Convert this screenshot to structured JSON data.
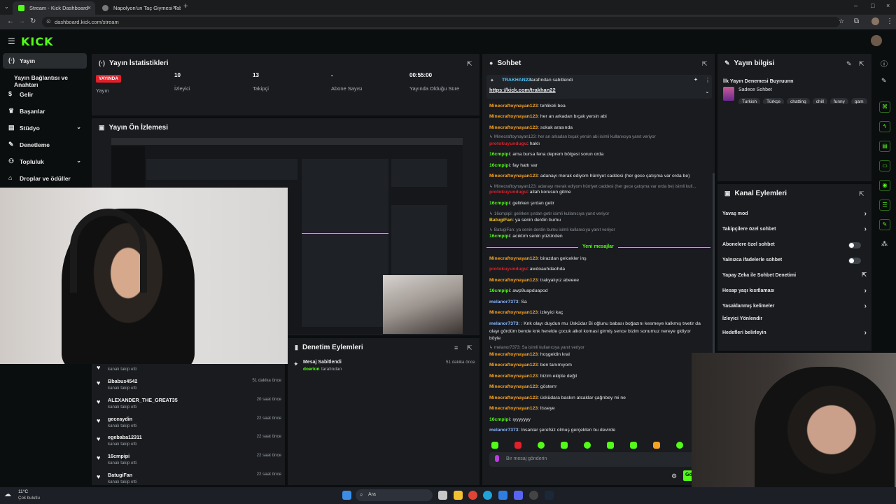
{
  "browser": {
    "tabs": [
      {
        "title": "Stream - Kick Dashboard",
        "active": true
      },
      {
        "title": "Napolyon'un Taç Giymesi Tablo",
        "active": false
      }
    ],
    "url": "dashboard.kick.com/stream"
  },
  "brand": {
    "logo": "KICK",
    "accent": "#53fc18"
  },
  "sidebar": {
    "items": [
      {
        "label": "Yayın",
        "icon": "broadcast-icon",
        "active": true
      },
      {
        "label": "Yayın Bağlantısı ve Anahtarı",
        "icon": "",
        "active": false
      },
      {
        "label": "Gelir",
        "icon": "dollar-icon",
        "active": false
      },
      {
        "label": "Başarılar",
        "icon": "trophy-icon",
        "active": false
      },
      {
        "label": "Stüdyo",
        "icon": "studio-icon",
        "active": false
      },
      {
        "label": "Denetleme",
        "icon": "wrench-icon",
        "active": false
      },
      {
        "label": "Topluluk",
        "icon": "community-icon",
        "active": false
      },
      {
        "label": "Droplar ve ödüller",
        "icon": "gift-icon",
        "active": false
      }
    ]
  },
  "stats": {
    "title": "Yayın İstatistikleri",
    "live_badge": "YAYINDA",
    "items": [
      {
        "value": "",
        "label": "Yayın"
      },
      {
        "value": "10",
        "label": "İzleyici"
      },
      {
        "value": "13",
        "label": "Takipçi"
      },
      {
        "value": "-",
        "label": "Abone Sayısı"
      },
      {
        "value": "00:55:00",
        "label": "Yayında Olduğu Süre"
      }
    ]
  },
  "preview": {
    "title": "Yayın Ön İzlemesi"
  },
  "feed": {
    "items": [
      {
        "name": "",
        "sub": "kanalı takip etti",
        "time": ""
      },
      {
        "name": "Bbabus4542",
        "sub": "kanalı takip etti",
        "time": "51 dakika önce"
      },
      {
        "name": "ALEXANDER_THE_GREAT35",
        "sub": "kanalı takip etti",
        "time": "20 saat önce"
      },
      {
        "name": "geceaydin",
        "sub": "kanalı takip etti",
        "time": "22 saat önce"
      },
      {
        "name": "egebaba12311",
        "sub": "kanalı takip etti",
        "time": "22 saat önce"
      },
      {
        "name": "16cmpipi",
        "sub": "kanalı takip etti",
        "time": "22 saat önce"
      },
      {
        "name": "BatugiFan",
        "sub": "kanalı takip etti",
        "time": "22 saat önce"
      }
    ]
  },
  "mod_actions": {
    "title": "Denetim Eylemleri",
    "item_title": "Mesaj Sabitlendi",
    "item_user": "doerkın",
    "item_suffix": "tarafından",
    "item_time": "51 dakika önce"
  },
  "chat": {
    "title": "Sohbet",
    "pinned_by_user": "TRAKHAN22",
    "pinned_by_suffix": "tarafından sabitlendi",
    "pinned_link": "https://kick.com/trakhan22",
    "new_messages_label": "Yeni mesajlar",
    "input_placeholder": "Bir mesaj gönderin",
    "send_label": "Gö",
    "lines": [
      {
        "type": "msg",
        "user": "Minecraftoynayan123",
        "color": "#f7a123",
        "text": ": tehlikeli bea"
      },
      {
        "type": "msg",
        "user": "Minecraftoynayan123",
        "color": "#f7a123",
        "text": ": her an arkadan bıçak yersin abi"
      },
      {
        "type": "msg",
        "user": "Minecraftoynayan123",
        "color": "#f7a123",
        "text": ": sokak arasında"
      },
      {
        "type": "reply",
        "text": "↳ Minecraftoynayan123: her an arkadan bıçak yersin abi isimli kullanıcıya yanıt veriyor"
      },
      {
        "type": "msg",
        "user": "protokuyundugu",
        "color": "#e0202a",
        "text": ": haklı"
      },
      {
        "type": "msg",
        "user": "16cmpipi",
        "color": "#53fc18",
        "text": ": ama bursa fena deprem bölgesi sorun orda"
      },
      {
        "type": "msg",
        "user": "16cmpipi",
        "color": "#53fc18",
        "text": ": fay hattı var"
      },
      {
        "type": "msg",
        "user": "Minecraftoynayan123",
        "color": "#f7a123",
        "text": ": adanayı merak ediyom hürriyet caddesi (her gece çatışma var orda be)"
      },
      {
        "type": "reply",
        "text": "↳ Minecraftoynayan123: adanayı merak ediyom hürriyet caddesi (her gece çatışma var orda be) isimli kull..."
      },
      {
        "type": "msg",
        "user": "protokuyundugu",
        "color": "#e0202a",
        "text": ": allah korusun gitme"
      },
      {
        "type": "msg",
        "user": "16cmpipi",
        "color": "#53fc18",
        "text": ": gelirken şırdan getir"
      },
      {
        "type": "reply",
        "text": "↳ 16cmpipi: gelirken şırdan getir isimli kullanıcıya yanıt veriyor"
      },
      {
        "type": "msg",
        "user": "BatugiFan",
        "color": "#f7c623",
        "text": ": ya senin derdin bumu"
      },
      {
        "type": "reply",
        "text": "↳ BatugiFan: ya senin derdin bumu isimli kullanıcıya yanıt veriyor"
      },
      {
        "type": "msg",
        "user": "16cmpipi",
        "color": "#53fc18",
        "text": ": acıktım senin yüzünden"
      },
      {
        "type": "msg",
        "user": "Minecraftoynayan123",
        "color": "#f7a123",
        "text": ": birazdan gelcekler inş"
      },
      {
        "type": "msg",
        "user": "protokuyundugu",
        "color": "#e0202a",
        "text": ": awdoauhdaohda"
      },
      {
        "type": "msg",
        "user": "Minecraftoynayan123",
        "color": "#f7a123",
        "text": ": trakyalıyız abeeee"
      },
      {
        "type": "msg",
        "user": "16cmpipi",
        "color": "#53fc18",
        "text": ": awp9uapduapod"
      },
      {
        "type": "msg",
        "user": "melanor7373",
        "color": "#8ab4f8",
        "text": ": Sa"
      },
      {
        "type": "msg",
        "user": "Minecraftoynayan123",
        "color": "#f7a123",
        "text": ": izleyici kaç"
      },
      {
        "type": "msg",
        "user": "melanor7373",
        "color": "#8ab4f8",
        "text": ": : Knk olayı duydun mu Üsküdar Bi oğlunu babası boğazını kesmeye kalkmış twetir da"
      },
      {
        "type": "cont",
        "text": "olayı gördüm bende knk herelde çocuk alkol komasi girmiş sence bizim sonumuz nereye gidiyor"
      },
      {
        "type": "cont",
        "text": "böyle"
      },
      {
        "type": "reply",
        "text": "↳ melanor7373: Sa isimli kullanıcıya yanıt veriyor"
      },
      {
        "type": "msg",
        "user": "Minecraftoynayan123",
        "color": "#f7a123",
        "text": ": hoşgeldin kral"
      },
      {
        "type": "msg",
        "user": "Minecraftoynayan123",
        "color": "#f7a123",
        "text": ": ben tanımıyom"
      },
      {
        "type": "msg",
        "user": "Minecraftoynayan123",
        "color": "#f7a123",
        "text": ": bizim ekipte değil"
      },
      {
        "type": "msg",
        "user": "Minecraftoynayan123",
        "color": "#f7a123",
        "text": ": gösterrr"
      },
      {
        "type": "msg",
        "user": "Minecraftoynayan123",
        "color": "#f7a123",
        "text": ": üsküdara baskın atcaklar çağrıbey mi ne"
      },
      {
        "type": "msg",
        "user": "Minecraftoynayan123",
        "color": "#f7a123",
        "text": ": lisseye"
      },
      {
        "type": "msg",
        "user": "16cmpipi",
        "color": "#53fc18",
        "text": ": ıyyyyyyy"
      },
      {
        "type": "msg",
        "user": "melanor7373",
        "color": "#8ab4f8",
        "text": ": İnsanlar şerefsiz olmuş gerçekten bu devirde"
      }
    ]
  },
  "stream_info": {
    "title": "Yayın bilgisi",
    "stream_title": "İlk Yayın Denemesi Buyruunn",
    "category": "Sadece Sohbet",
    "tags": [
      "Turkish",
      "Türkçe",
      "chatting",
      "chill",
      "funny",
      "gam"
    ]
  },
  "channel_actions": {
    "title": "Kanal Eylemleri",
    "items": [
      {
        "label": "Yavaş mod",
        "control": "chevron"
      },
      {
        "label": "Takipçilere özel sohbet",
        "control": "chevron"
      },
      {
        "label": "Abonelere özel sohbet",
        "control": "toggle"
      },
      {
        "label": "Yalnızca ifadelerle sohbet",
        "control": "toggle"
      },
      {
        "label": "Yapay Zeka ile Sohbet Denetimi",
        "control": "external"
      },
      {
        "label": "Hesap yaşı kısıtlaması",
        "control": "chevron"
      },
      {
        "label": "Yasaklanmış kelimeler",
        "control": "chevron"
      },
      {
        "label": "İzleyici Yönlendir",
        "control": "none"
      },
      {
        "label": "Hedefleri belirleyin",
        "control": "chevron"
      }
    ]
  },
  "taskbar": {
    "weather_temp": "11°C",
    "weather_desc": "Çok bulutlu",
    "search_placeholder": "Ara"
  }
}
